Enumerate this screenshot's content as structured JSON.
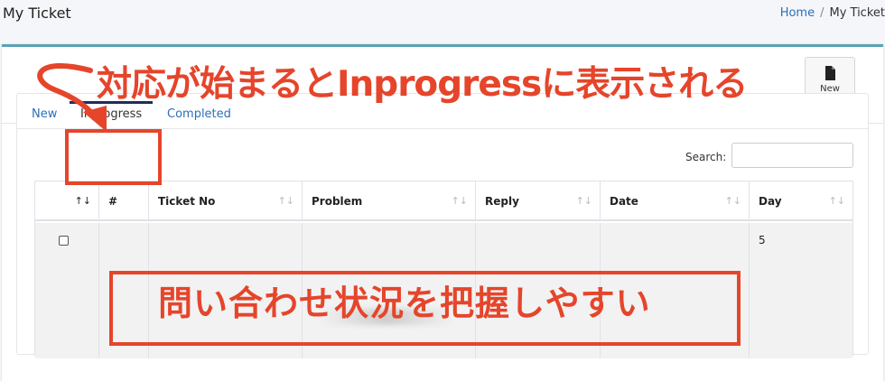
{
  "header": {
    "title": "My Ticket",
    "breadcrumb": {
      "home": "Home",
      "separator": "/",
      "current": "My Ticket"
    }
  },
  "toolbar": {
    "new_label": "New"
  },
  "tabs": [
    {
      "label": "New",
      "active": false
    },
    {
      "label": "Inprogress",
      "active": true
    },
    {
      "label": "Completed",
      "active": false
    }
  ],
  "search": {
    "label": "Search:",
    "value": ""
  },
  "table": {
    "columns": [
      "#",
      "Ticket No",
      "Problem",
      "Reply",
      "Date",
      "Day"
    ],
    "rows": [
      {
        "checked": false,
        "number": "",
        "ticket_no": "",
        "problem": "",
        "reply": "",
        "date": "",
        "day": "5"
      }
    ]
  },
  "annotations": {
    "title": "対応が始まるとInprogressに表示される",
    "body": "問い合わせ状況を把握しやすい",
    "color": "#e5452b"
  },
  "colors": {
    "link": "#2d6fb6",
    "card_top_border": "#5aa3b3",
    "active_tab": "#1f2d5c"
  }
}
